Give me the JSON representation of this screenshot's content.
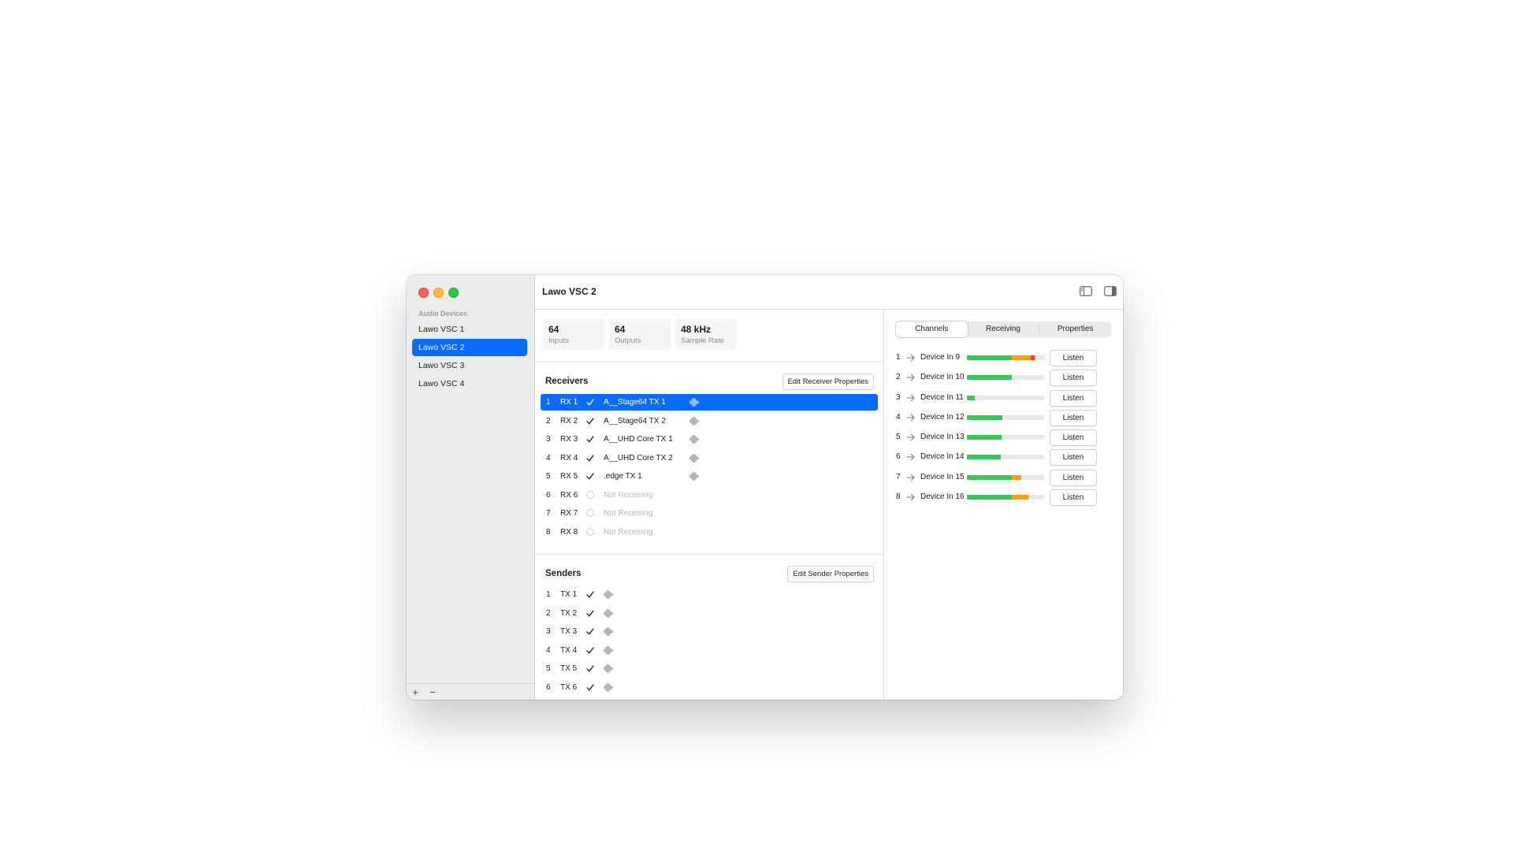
{
  "sidebar": {
    "heading": "Audio Devices",
    "items": [
      {
        "label": "Lawo VSC 1",
        "selected": false
      },
      {
        "label": "Lawo VSC 2",
        "selected": true
      },
      {
        "label": "Lawo VSC 3",
        "selected": false
      },
      {
        "label": "Lawo VSC 4",
        "selected": false
      }
    ],
    "add_label": "+",
    "remove_label": "−"
  },
  "header": {
    "title": "Lawo VSC 2",
    "icons": [
      "sidebar-left-icon",
      "sidebar-right-icon"
    ]
  },
  "stats": [
    {
      "value": "64",
      "label": "Inputs"
    },
    {
      "value": "64",
      "label": "Outputs"
    },
    {
      "value": "48 kHz",
      "label": "Sample Rate"
    }
  ],
  "receivers": {
    "title": "Receivers",
    "edit_label": "Edit Receiver Properties",
    "rows": [
      {
        "num": "1",
        "name": "RX 1",
        "status": "check",
        "source": "A__Stage64 TX 1",
        "active": true,
        "selected": true
      },
      {
        "num": "2",
        "name": "RX 2",
        "status": "check",
        "source": "A__Stage64 TX 2",
        "active": true,
        "selected": false
      },
      {
        "num": "3",
        "name": "RX 3",
        "status": "check",
        "source": "A__UHD Core TX 1",
        "active": true,
        "selected": false
      },
      {
        "num": "4",
        "name": "RX 4",
        "status": "check",
        "source": "A__UHD Core TX 2",
        "active": true,
        "selected": false
      },
      {
        "num": "5",
        "name": "RX 5",
        "status": "check",
        "source": ".edge TX 1",
        "active": true,
        "selected": false
      },
      {
        "num": "6",
        "name": "RX 6",
        "status": "ring",
        "source": "Not Receiving",
        "active": false,
        "selected": false
      },
      {
        "num": "7",
        "name": "RX 7",
        "status": "ring",
        "source": "Not Receiving",
        "active": false,
        "selected": false
      },
      {
        "num": "8",
        "name": "RX 8",
        "status": "ring",
        "source": "Not Receiving",
        "active": false,
        "selected": false
      }
    ]
  },
  "senders": {
    "title": "Senders",
    "edit_label": "Edit Sender Properties",
    "rows": [
      {
        "num": "1",
        "name": "TX 1"
      },
      {
        "num": "2",
        "name": "TX 2"
      },
      {
        "num": "3",
        "name": "TX 3"
      },
      {
        "num": "4",
        "name": "TX 4"
      },
      {
        "num": "5",
        "name": "TX 5"
      },
      {
        "num": "6",
        "name": "TX 6"
      }
    ]
  },
  "tabs": [
    {
      "label": "Channels",
      "active": true
    },
    {
      "label": "Receiving",
      "active": false
    },
    {
      "label": "Properties",
      "active": false
    }
  ],
  "channels": {
    "listen_label": "Listen",
    "rows": [
      {
        "num": "1",
        "name": "Device In 9",
        "green": 0.58,
        "orange": 0.25,
        "red": 0.05
      },
      {
        "num": "2",
        "name": "Device In 10",
        "green": 0.58,
        "orange": 0.0,
        "red": 0.0
      },
      {
        "num": "3",
        "name": "Device In 11",
        "green": 0.1,
        "orange": 0.0,
        "red": 0.0
      },
      {
        "num": "4",
        "name": "Device In 12",
        "green": 0.46,
        "orange": 0.0,
        "red": 0.0
      },
      {
        "num": "5",
        "name": "Device In 13",
        "green": 0.45,
        "orange": 0.0,
        "red": 0.0
      },
      {
        "num": "6",
        "name": "Device In 14",
        "green": 0.44,
        "orange": 0.0,
        "red": 0.0
      },
      {
        "num": "7",
        "name": "Device In 15",
        "green": 0.58,
        "orange": 0.12,
        "red": 0.0
      },
      {
        "num": "8",
        "name": "Device In 16",
        "green": 0.58,
        "orange": 0.22,
        "red": 0.0
      }
    ]
  },
  "colors": {
    "accent": "#0a6cff",
    "meter_green": "#34c759",
    "meter_orange": "#ff9f0a",
    "meter_red": "#ff3b30"
  }
}
